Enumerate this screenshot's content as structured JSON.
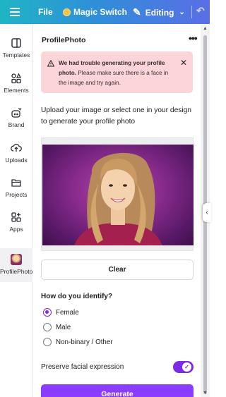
{
  "topbar": {
    "file_label": "File",
    "magic_label": "Magic Switch",
    "editing_label": "Editing"
  },
  "rail": {
    "items": [
      {
        "label": "Templates",
        "icon": "templates-icon"
      },
      {
        "label": "Elements",
        "icon": "elements-icon"
      },
      {
        "label": "Brand",
        "icon": "brand-icon"
      },
      {
        "label": "Uploads",
        "icon": "upload-icon"
      },
      {
        "label": "Projects",
        "icon": "folder-icon"
      },
      {
        "label": "Apps",
        "icon": "apps-icon"
      },
      {
        "label": "ProfilePhoto",
        "icon": "profilephoto-app-icon"
      }
    ]
  },
  "panel": {
    "title": "ProfilePhoto",
    "error": {
      "bold": "We had trouble generating your profile photo.",
      "rest": " Please make sure there is a face in the image and try again."
    },
    "intro": "Upload your image or select one in your design to generate your profile photo",
    "clear_label": "Clear",
    "identify_label": "How do you identify?",
    "options": [
      {
        "label": "Female",
        "checked": true
      },
      {
        "label": "Male",
        "checked": false
      },
      {
        "label": "Non-binary / Other",
        "checked": false
      }
    ],
    "preserve_label": "Preserve facial expression",
    "preserve_on": true,
    "generate_label": "Generate"
  },
  "colors": {
    "accent": "#8b3dff",
    "error_bg": "#fbd5d8"
  }
}
